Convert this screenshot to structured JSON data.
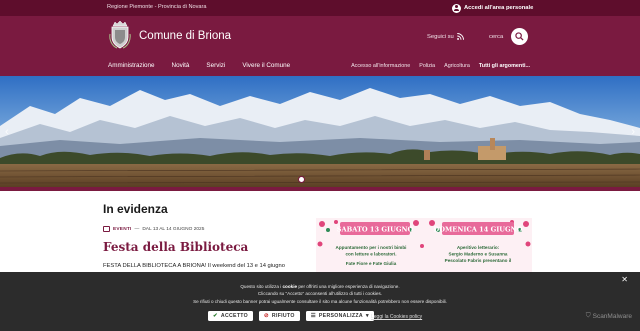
{
  "topbar": {
    "region": "Regione Piemonte - Provincia di Novara",
    "login_label": "Accedi all'area personale"
  },
  "header": {
    "title": "Comune di Briona",
    "follow_label": "Seguici su",
    "search_label": "cerca"
  },
  "nav_main": [
    "Amministrazione",
    "Novità",
    "Servizi",
    "Vivere il Comune"
  ],
  "nav_secondary": [
    "Accesso all'informazione",
    "Polizia",
    "Agricoltura",
    "Tutti gli argomenti..."
  ],
  "hero": {
    "prev_arrow": "‹",
    "next_arrow": "›"
  },
  "highlight": {
    "section_title": "In evidenza",
    "category": "EVENTI",
    "separator": "—",
    "date": "DAL 13 AL 14 GIUGNO 2025",
    "event_title": "Festa della Biblioteca",
    "event_desc": "FESTA DELLA BIBLIOTECA A BRIONA! Il weekend del 13 e 14 giugno"
  },
  "poster": {
    "left_header": "SABATO 13 GIUGNO",
    "right_header": "DOMENICA 14 GIUGNO",
    "left_line1": "Appuntamento per i nostri bimbi",
    "left_line2": "con letture e laboratori.",
    "left_line3": "Fate Fiore e Fate Giulia",
    "right_line1": "Aperitivo letterario:",
    "right_line2": "Sergio Maderno e Susanna",
    "right_line3": "Pescolato Fabris presentano il"
  },
  "cookie": {
    "close": "✕",
    "line1_pre": "Questo sito utilizza i ",
    "line1_bold": "cookie",
    "line1_post": " per offrirti una migliore esperienza di navigazione.",
    "line2": "Cliccando su \"Accetto\" acconsenti all'utilizzo di tutti i cookies.",
    "line3": "Se rifiuti o chiudi questo banner potrai ugualmente consultare il sito ma alcune funzionalità potrebbero non essere disponibili.",
    "accept_label": "ACCETTO",
    "reject_label": "RIFIUTO",
    "customize_label": "PERSONALIZZA",
    "policy_label": "Leggi la Cookies policy",
    "watermark": "ScanMalware"
  },
  "icons": {
    "login": "user-circle-icon",
    "rss": "rss-icon",
    "search": "search-icon",
    "calendar": "calendar-icon",
    "accept": "check-icon",
    "reject": "ban-icon",
    "customize": "sliders-icon"
  },
  "colors": {
    "brand_dark": "#5e0d2c",
    "brand": "#7a1a40",
    "cookie_bg": "#1c1c1c"
  }
}
